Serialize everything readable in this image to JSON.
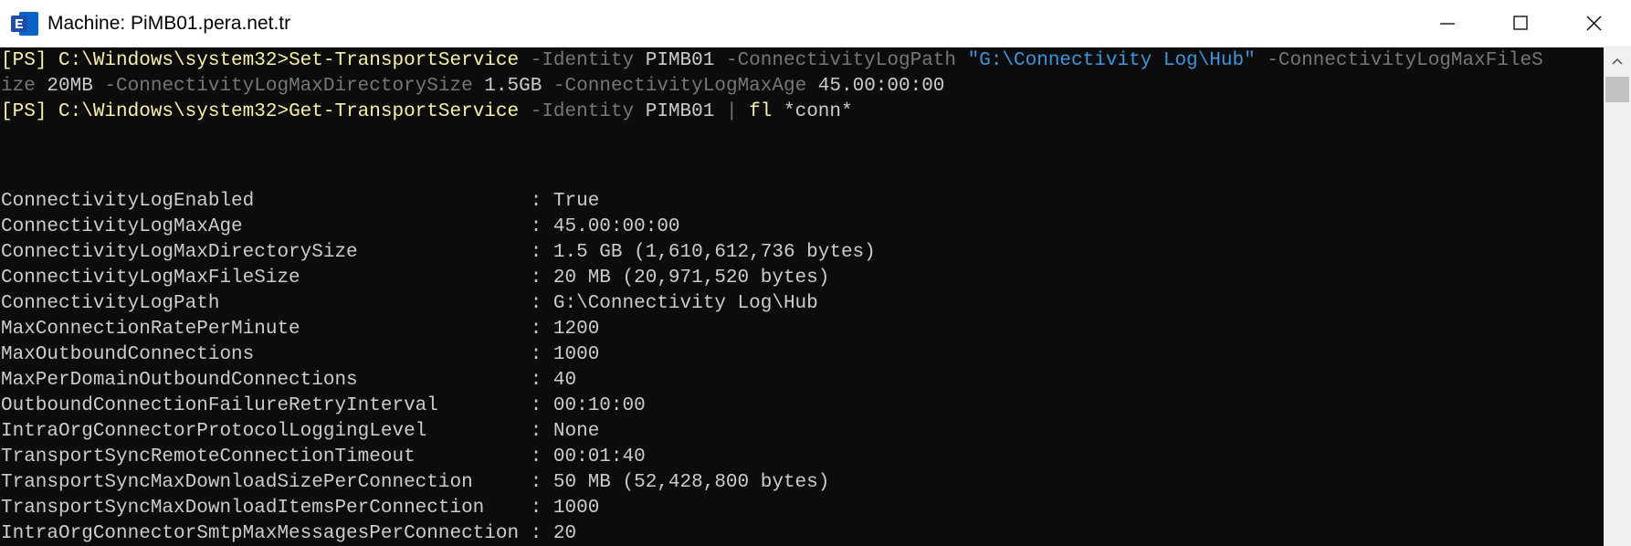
{
  "window": {
    "title": "Machine: PiMB01.pera.net.tr",
    "app_icon": "exchange-management-shell-icon",
    "controls": {
      "minimize": "minimize-icon",
      "maximize": "maximize-icon",
      "close": "close-icon"
    }
  },
  "colors": {
    "console_bg": "#0c0c0c",
    "default_text": "#cccccc",
    "prompt_and_command": "#f9f1a5",
    "parameter": "#767676",
    "string": "#3a96dd",
    "icon_blue": "#0a64c8"
  },
  "console": {
    "prompt": "[PS] C:\\Windows\\system32>",
    "command1": {
      "cmdlet": "Set-TransportService",
      "p_identity": " -Identity",
      "v_identity": " PIMB01",
      "p_logpath": " -ConnectivityLogPath",
      "v_logpath": " \"G:\\Connectivity Log\\Hub\"",
      "p_maxfilesize_a": " -ConnectivityLogMaxFileS",
      "p_maxfilesize_b": "ize",
      "v_maxfilesize": " 20MB",
      "p_maxdirsize": " -ConnectivityLogMaxDirectorySize",
      "v_maxdirsize": " 1.5GB",
      "p_maxage": " -ConnectivityLogMaxAge",
      "v_maxage": " 45.00:00:00"
    },
    "command2": {
      "cmdlet": "Get-TransportService",
      "p_identity": " -Identity",
      "v_identity": " PIMB01",
      "pipe": " |",
      "fl": " fl",
      "filter": " *conn*"
    },
    "output": [
      "ConnectivityLogEnabled                        : True",
      "ConnectivityLogMaxAge                         : 45.00:00:00",
      "ConnectivityLogMaxDirectorySize               : 1.5 GB (1,610,612,736 bytes)",
      "ConnectivityLogMaxFileSize                    : 20 MB (20,971,520 bytes)",
      "ConnectivityLogPath                           : G:\\Connectivity Log\\Hub",
      "MaxConnectionRatePerMinute                    : 1200",
      "MaxOutboundConnections                        : 1000",
      "MaxPerDomainOutboundConnections               : 40",
      "OutboundConnectionFailureRetryInterval        : 00:10:00",
      "IntraOrgConnectorProtocolLoggingLevel         : None",
      "TransportSyncRemoteConnectionTimeout          : 00:01:40",
      "TransportSyncMaxDownloadSizePerConnection     : 50 MB (52,428,800 bytes)",
      "TransportSyncMaxDownloadItemsPerConnection    : 1000",
      "IntraOrgConnectorSmtpMaxMessagesPerConnection : 20"
    ]
  },
  "scrollbar": {
    "up_arrow": "chevron-up-icon"
  }
}
